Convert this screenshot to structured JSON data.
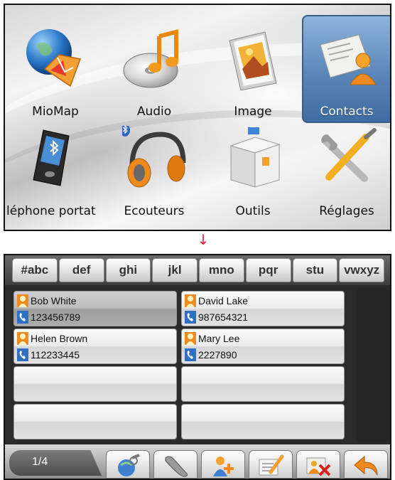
{
  "top_menu": {
    "items": [
      {
        "label": "MioMap",
        "icon": "globe-map-icon"
      },
      {
        "label": "Audio",
        "icon": "music-disc-icon"
      },
      {
        "label": "Image",
        "icon": "picture-frame-icon"
      },
      {
        "label": "Contacts",
        "icon": "contacts-card-icon",
        "selected": true
      },
      {
        "label": "léphone portat",
        "icon": "bluetooth-phone-icon"
      },
      {
        "label": "Ecouteurs",
        "icon": "bluetooth-headphones-icon"
      },
      {
        "label": "Outils",
        "icon": "toolbox-icon"
      },
      {
        "label": "Réglages",
        "icon": "wrench-screwdriver-icon"
      }
    ],
    "selected_color": "#5a86b8"
  },
  "arrow": "↓",
  "contacts_screen": {
    "tabs": [
      "#abc",
      "def",
      "ghi",
      "jkl",
      "mno",
      "pqr",
      "stu",
      "vwxyz"
    ],
    "contacts": [
      {
        "name": "Bob White",
        "number": "123456789",
        "selected": true
      },
      {
        "name": "David Lake",
        "number": "987654321"
      },
      {
        "name": "Helen Brown",
        "number": "112233445"
      },
      {
        "name": "Mary Lee",
        "number": "2227890"
      }
    ],
    "page": "1/4",
    "toolbar_buttons": [
      "globe-search-icon",
      "phone-handset-icon",
      "add-contact-icon",
      "edit-note-icon",
      "delete-contact-icon",
      "back-arrow-icon"
    ]
  }
}
